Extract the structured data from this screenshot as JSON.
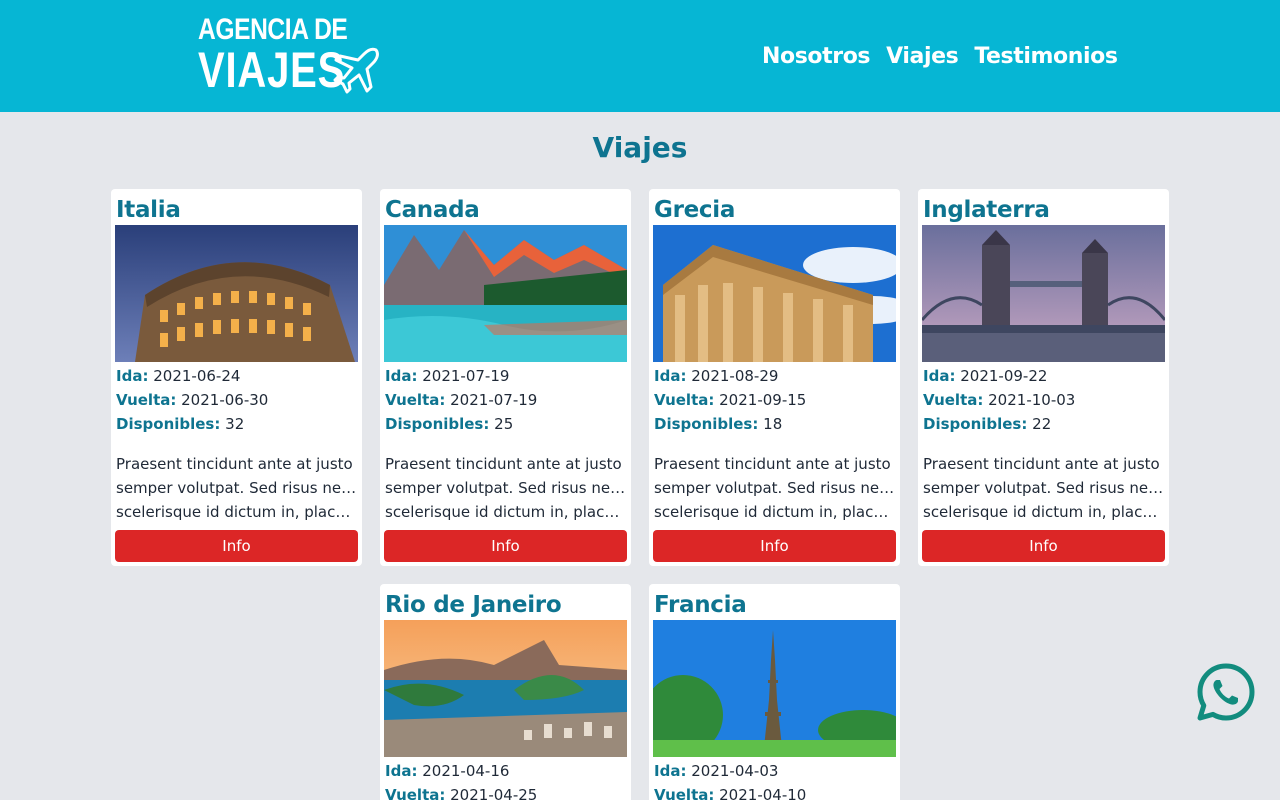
{
  "header": {
    "logo_line1": "AGENCIA DE",
    "logo_line2": "VIAJES",
    "nav": [
      "Nosotros",
      "Viajes",
      "Testimonios"
    ]
  },
  "page_title": "Viajes",
  "labels": {
    "ida": "Ida:",
    "vuelta": "Vuelta:",
    "disponibles": "Disponibles:",
    "button": "Info"
  },
  "trips": [
    {
      "name": "Italia",
      "ida": "2021-06-24",
      "vuelta": "2021-06-30",
      "disponibles": "32",
      "desc": [
        "Praesent tincidunt ante at justo",
        "semper volutpat. Sed risus neque,",
        "scelerisque id dictum in, placera..."
      ]
    },
    {
      "name": "Canada",
      "ida": "2021-07-19",
      "vuelta": "2021-07-19",
      "disponibles": "25",
      "desc": [
        "Praesent tincidunt ante at justo",
        "semper volutpat. Sed risus neque,",
        "scelerisque id dictum in, placera..."
      ]
    },
    {
      "name": "Grecia",
      "ida": "2021-08-29",
      "vuelta": "2021-09-15",
      "disponibles": "18",
      "desc": [
        "Praesent tincidunt ante at justo",
        "semper volutpat. Sed risus neque,",
        "scelerisque id dictum in, placera..."
      ]
    },
    {
      "name": "Inglaterra",
      "ida": "2021-09-22",
      "vuelta": "2021-10-03",
      "disponibles": "22",
      "desc": [
        "Praesent tincidunt ante at justo",
        "semper volutpat. Sed risus neque,",
        "scelerisque id dictum in, placera..."
      ]
    },
    {
      "name": "Rio de Janeiro",
      "ida": "2021-04-16",
      "vuelta": "2021-04-25"
    },
    {
      "name": "Francia",
      "ida": "2021-04-03",
      "vuelta": "2021-04-10"
    }
  ],
  "icons": {
    "logo": "airplane-icon",
    "whatsapp": "whatsapp-icon"
  },
  "colors": {
    "header": "#06b6d4",
    "accent": "#0e7490",
    "button": "#dc2626",
    "background": "#e5e7eb",
    "whatsapp": "#128c7e"
  }
}
